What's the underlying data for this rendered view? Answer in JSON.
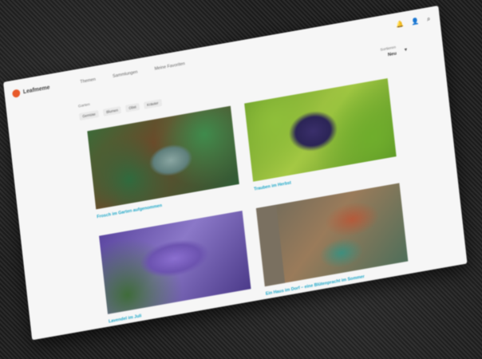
{
  "app": {
    "brand": "Leafmeme"
  },
  "nav": {
    "items": [
      {
        "label": "Themen"
      },
      {
        "label": "Sammlungen"
      },
      {
        "label": "Meine Favoriten"
      }
    ]
  },
  "sort": {
    "label": "Sortieren",
    "value": "Neu"
  },
  "section": {
    "label": "Garten",
    "filters": [
      "Gemüse",
      "Blumen",
      "Obst",
      "Kräuter"
    ]
  },
  "cards": [
    {
      "title": "Frosch im Garten aufgenommen",
      "meta": "♡ ◦",
      "icon": "dragonfly"
    },
    {
      "title": "Trauben im Herbst",
      "meta": "♡ ◦",
      "icon": "grapes"
    },
    {
      "title": "Lavendel im Juli",
      "meta": "♡ ◦",
      "icon": "lavender"
    },
    {
      "title": "Ein Haus im Dorf – eine Blütenpracht im Sommer",
      "meta": "♡ ◦",
      "icon": "house"
    }
  ],
  "icons": {
    "brand": "flower-logo-icon",
    "bell": "bell-icon",
    "user": "user-icon",
    "search": "search-icon",
    "chevron": "chevron-down-icon"
  },
  "colors": {
    "accent": "#1aa6c7",
    "brand": "#e85a2a"
  }
}
